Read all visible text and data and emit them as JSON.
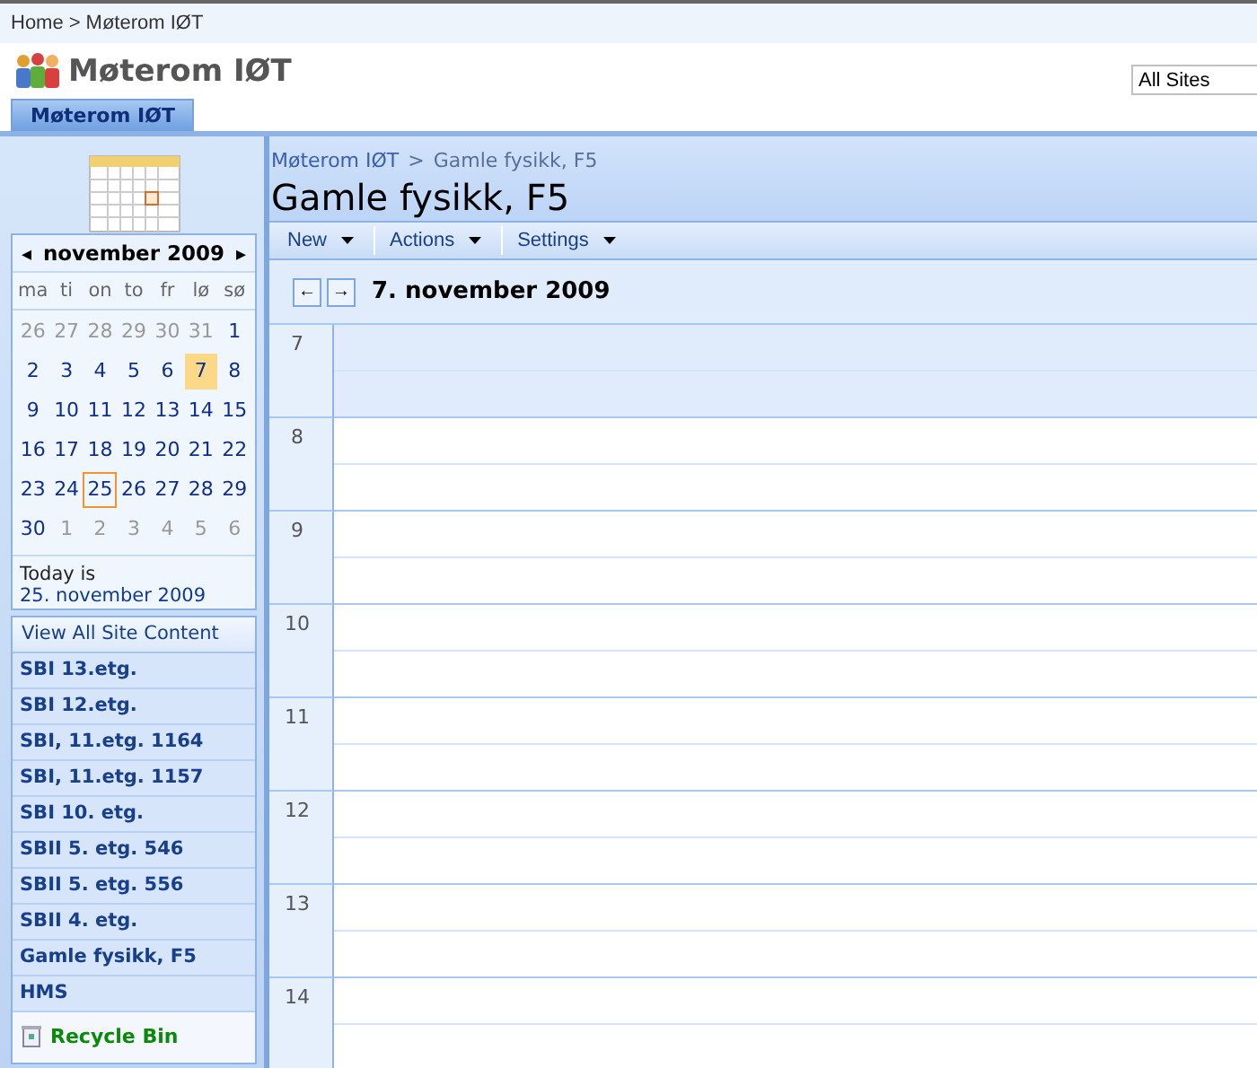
{
  "breadcrumb": {
    "items": [
      "Home",
      "Møterom IØT"
    ],
    "separator": ">"
  },
  "site_title": "Møterom IØT",
  "search_scope": "All Sites",
  "tabs": [
    {
      "label": "Møterom IØT",
      "selected": true
    }
  ],
  "page_breadcrumb": {
    "items": [
      "Møterom IØT",
      "Gamle fysikk, F5"
    ],
    "separator": ">"
  },
  "page_title": "Gamle fysikk, F5",
  "date_navigator": {
    "month": "november 2009",
    "prev": "◂",
    "next": "▸",
    "weekdays": [
      "ma",
      "ti",
      "on",
      "to",
      "fr",
      "lø",
      "sø"
    ],
    "weeks": [
      [
        {
          "d": "26",
          "muted": true,
          "selected": false,
          "today": false
        },
        {
          "d": "27",
          "muted": true,
          "selected": false,
          "today": false
        },
        {
          "d": "28",
          "muted": true,
          "selected": false,
          "today": false
        },
        {
          "d": "29",
          "muted": true,
          "selected": false,
          "today": false
        },
        {
          "d": "30",
          "muted": true,
          "selected": false,
          "today": false
        },
        {
          "d": "31",
          "muted": true,
          "selected": false,
          "today": false
        },
        {
          "d": "1",
          "muted": false,
          "selected": false,
          "today": false
        }
      ],
      [
        {
          "d": "2",
          "muted": false,
          "selected": false,
          "today": false
        },
        {
          "d": "3",
          "muted": false,
          "selected": false,
          "today": false
        },
        {
          "d": "4",
          "muted": false,
          "selected": false,
          "today": false
        },
        {
          "d": "5",
          "muted": false,
          "selected": false,
          "today": false
        },
        {
          "d": "6",
          "muted": false,
          "selected": false,
          "today": false
        },
        {
          "d": "7",
          "muted": false,
          "selected": true,
          "today": false
        },
        {
          "d": "8",
          "muted": false,
          "selected": false,
          "today": false
        }
      ],
      [
        {
          "d": "9",
          "muted": false,
          "selected": false,
          "today": false
        },
        {
          "d": "10",
          "muted": false,
          "selected": false,
          "today": false
        },
        {
          "d": "11",
          "muted": false,
          "selected": false,
          "today": false
        },
        {
          "d": "12",
          "muted": false,
          "selected": false,
          "today": false
        },
        {
          "d": "13",
          "muted": false,
          "selected": false,
          "today": false
        },
        {
          "d": "14",
          "muted": false,
          "selected": false,
          "today": false
        },
        {
          "d": "15",
          "muted": false,
          "selected": false,
          "today": false
        }
      ],
      [
        {
          "d": "16",
          "muted": false,
          "selected": false,
          "today": false
        },
        {
          "d": "17",
          "muted": false,
          "selected": false,
          "today": false
        },
        {
          "d": "18",
          "muted": false,
          "selected": false,
          "today": false
        },
        {
          "d": "19",
          "muted": false,
          "selected": false,
          "today": false
        },
        {
          "d": "20",
          "muted": false,
          "selected": false,
          "today": false
        },
        {
          "d": "21",
          "muted": false,
          "selected": false,
          "today": false
        },
        {
          "d": "22",
          "muted": false,
          "selected": false,
          "today": false
        }
      ],
      [
        {
          "d": "23",
          "muted": false,
          "selected": false,
          "today": false
        },
        {
          "d": "24",
          "muted": false,
          "selected": false,
          "today": false
        },
        {
          "d": "25",
          "muted": false,
          "selected": false,
          "today": true
        },
        {
          "d": "26",
          "muted": false,
          "selected": false,
          "today": false
        },
        {
          "d": "27",
          "muted": false,
          "selected": false,
          "today": false
        },
        {
          "d": "28",
          "muted": false,
          "selected": false,
          "today": false
        },
        {
          "d": "29",
          "muted": false,
          "selected": false,
          "today": false
        }
      ],
      [
        {
          "d": "30",
          "muted": false,
          "selected": false,
          "today": false
        },
        {
          "d": "1",
          "muted": true,
          "selected": false,
          "today": false
        },
        {
          "d": "2",
          "muted": true,
          "selected": false,
          "today": false
        },
        {
          "d": "3",
          "muted": true,
          "selected": false,
          "today": false
        },
        {
          "d": "4",
          "muted": true,
          "selected": false,
          "today": false
        },
        {
          "d": "5",
          "muted": true,
          "selected": false,
          "today": false
        },
        {
          "d": "6",
          "muted": true,
          "selected": false,
          "today": false
        }
      ]
    ],
    "today_label": "Today is",
    "today_date": "25. november 2009"
  },
  "quick_launch": {
    "header": "View All Site Content",
    "items": [
      "SBI 13.etg.",
      "SBI 12.etg.",
      "SBI, 11.etg. 1164",
      "SBI, 11.etg. 1157",
      "SBI 10. etg.",
      "SBII 5. etg. 546",
      "SBII 5. etg. 556",
      "SBII 4. etg.",
      "Gamle fysikk, F5",
      "HMS"
    ],
    "recycle_bin": "Recycle Bin"
  },
  "toolbar": [
    "New",
    "Actions",
    "Settings"
  ],
  "day_view": {
    "prev": "←",
    "next": "→",
    "date": "7. november 2009",
    "hours": [
      {
        "label": "7",
        "shaded": true
      },
      {
        "label": "8",
        "shaded": false
      },
      {
        "label": "9",
        "shaded": false
      },
      {
        "label": "10",
        "shaded": false
      },
      {
        "label": "11",
        "shaded": false
      },
      {
        "label": "12",
        "shaded": false
      },
      {
        "label": "13",
        "shaded": false
      },
      {
        "label": "14",
        "shaded": false
      }
    ]
  }
}
